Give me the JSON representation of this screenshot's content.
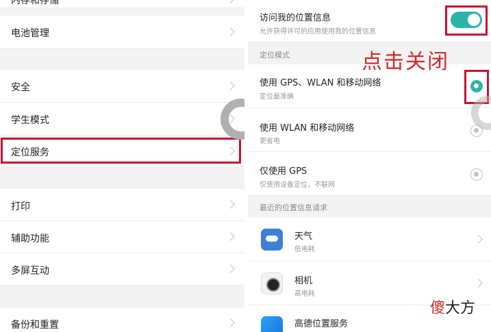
{
  "left": {
    "top_partial": "内存和存储",
    "items": [
      {
        "label": "电池管理"
      },
      {
        "label": "安全"
      },
      {
        "label": "学生模式"
      },
      {
        "label": "定位服务"
      },
      {
        "label": "打印"
      },
      {
        "label": "辅助功能"
      },
      {
        "label": "多屏互动"
      },
      {
        "label": "备份和重置"
      }
    ]
  },
  "right": {
    "access": {
      "title": "访问我的位置信息",
      "subtitle": "允许获得许可的应用使用我的位置信息",
      "enabled": true
    },
    "mode_header": "定位模式",
    "modes": [
      {
        "title": "使用 GPS、WLAN 和移动网络",
        "subtitle": "定位最准确",
        "selected": true
      },
      {
        "title": "使用 WLAN 和移动网络",
        "subtitle": "更省电",
        "selected": false
      },
      {
        "title": "仅使用 GPS",
        "subtitle": "仅使用设备定位，不联网",
        "selected": false
      }
    ],
    "recent_header": "最近的位置信息请求",
    "apps": [
      {
        "name": "天气",
        "usage": "低电耗",
        "icon": "weather-app-icon"
      },
      {
        "name": "相机",
        "usage": "高电耗",
        "icon": "camera-app-icon"
      },
      {
        "name": "高德位置服务",
        "usage": "",
        "icon": "amap-app-icon"
      }
    ]
  },
  "annotation": "点击关闭",
  "watermark": {
    "first": "傻",
    "rest": "大方"
  },
  "colors": {
    "accent": "#2bb5a8",
    "highlight": "#c8102e",
    "annotation": "#d12a2a"
  }
}
